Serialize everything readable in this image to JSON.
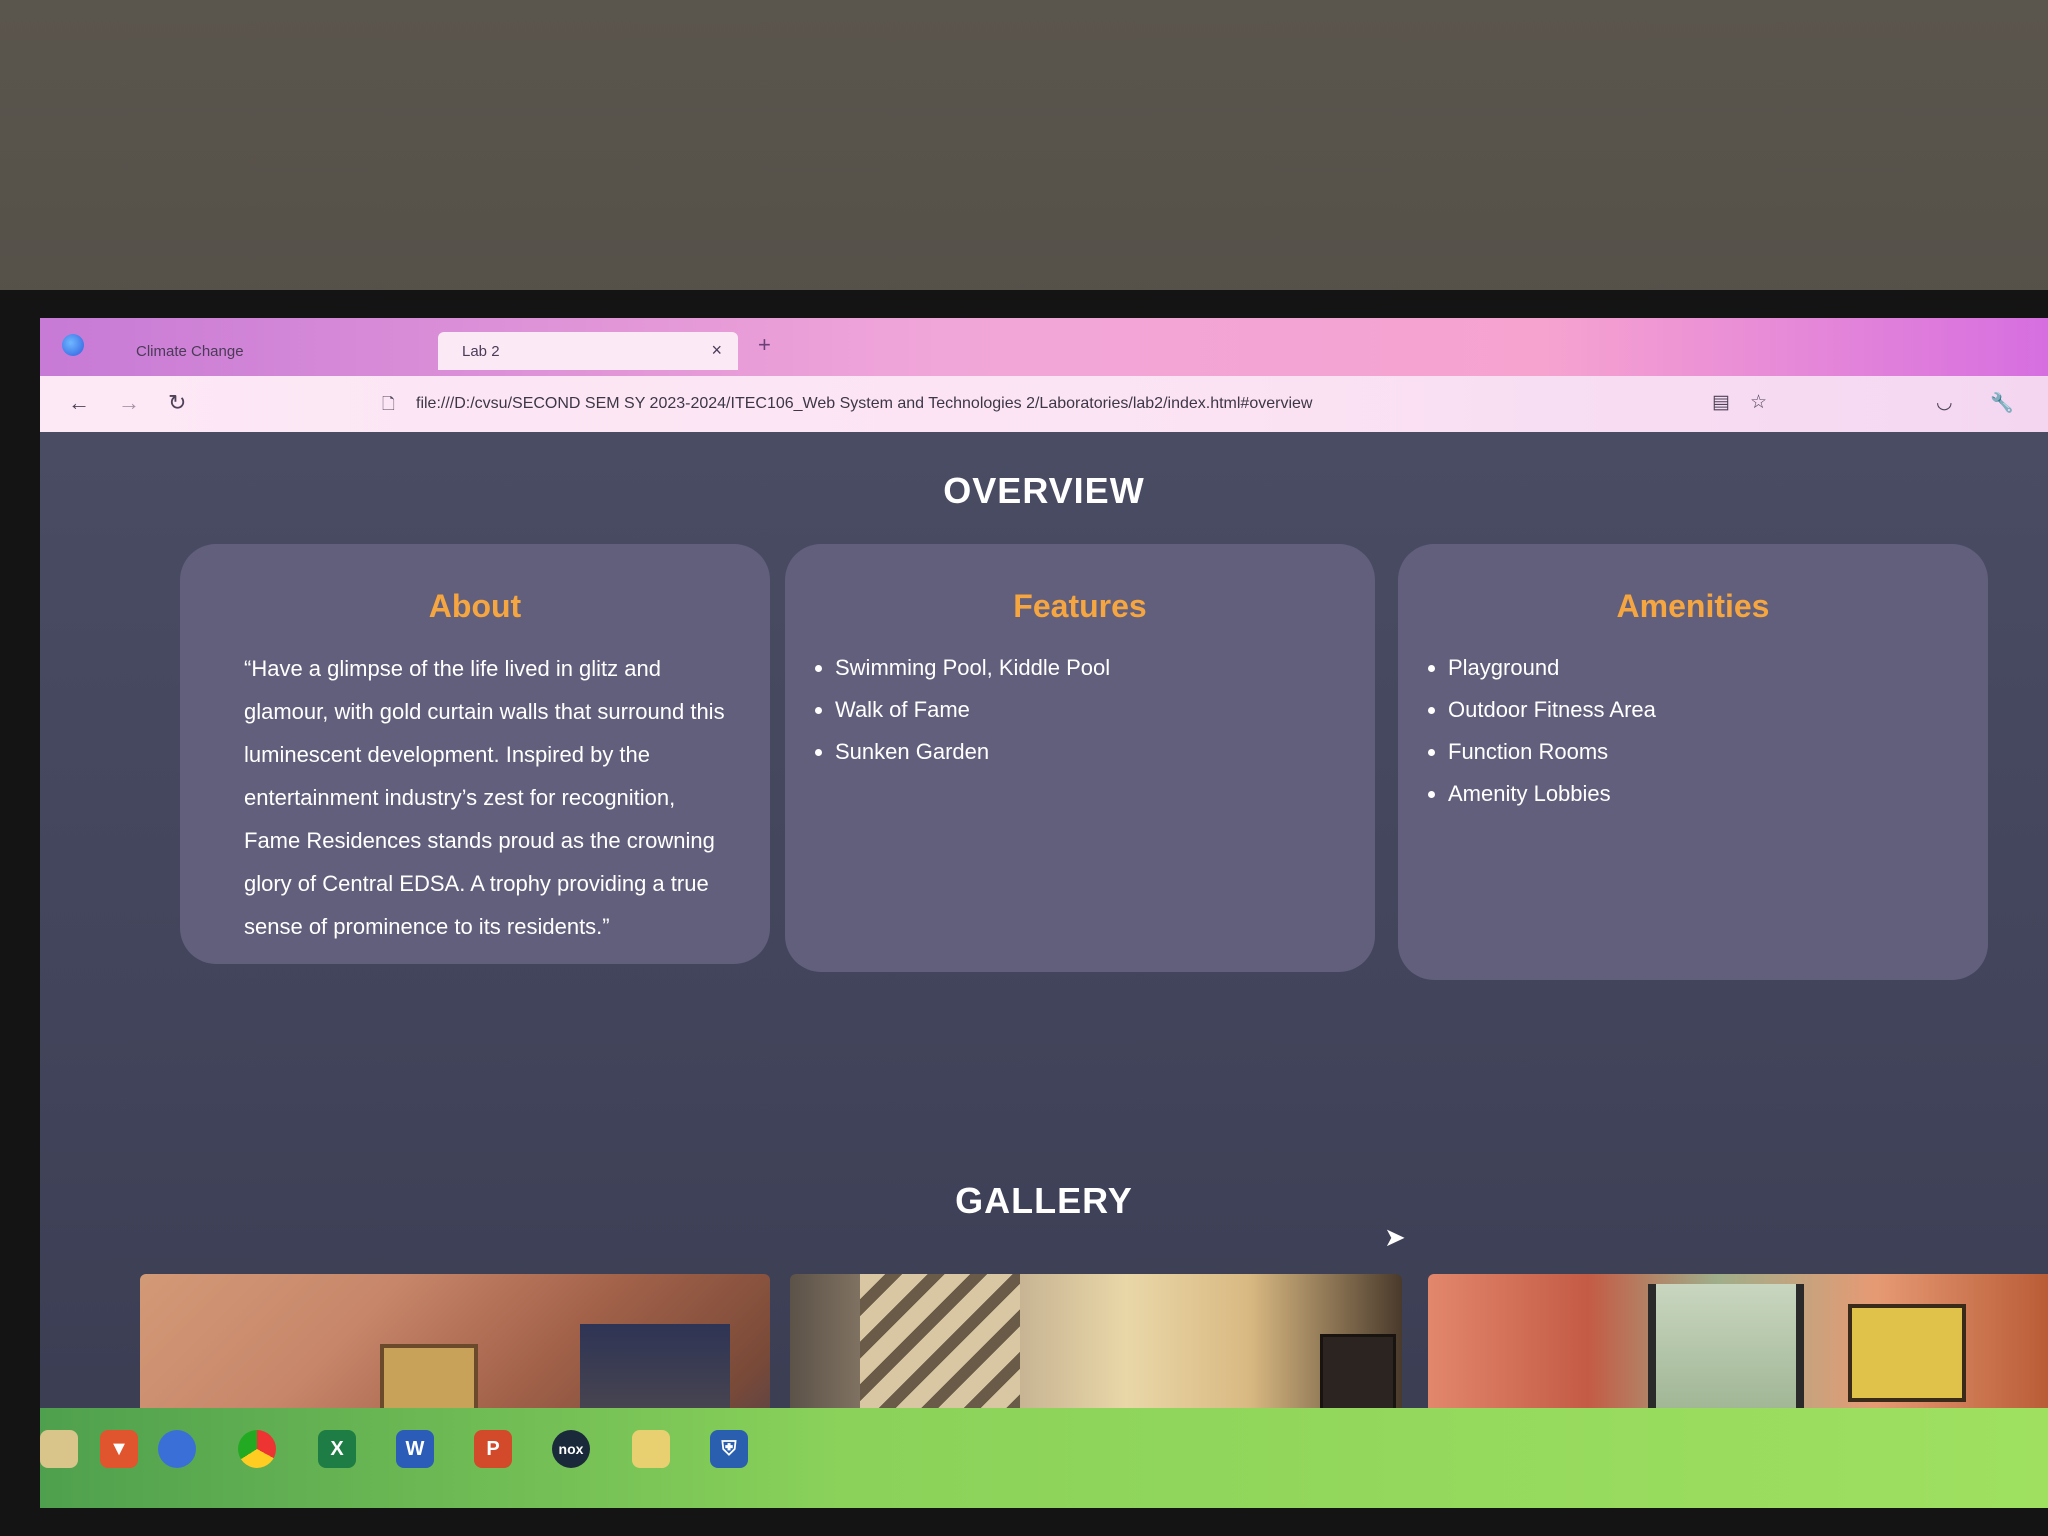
{
  "browser": {
    "tabs": [
      {
        "label": "Climate Change",
        "close": "×"
      },
      {
        "label": "Lab 2",
        "close": "×"
      }
    ],
    "new_tab": "+",
    "url": "file:///D:/cvsu/SECOND SEM SY 2023-2024/ITEC106_Web System and Technologies 2/Laboratories/lab2/index.html#overview",
    "icons": {
      "back": "←",
      "forward": "→",
      "reload": "↻",
      "page": "🗋",
      "reader": "▤",
      "bookmark": "☆",
      "pocket": "◡",
      "tools": "🔧",
      "dropdown": "⌄"
    }
  },
  "overview": {
    "title": "OVERVIEW",
    "about": {
      "heading": "About",
      "text": "“Have a glimpse of the life lived in glitz and glamour, with gold curtain walls that surround this luminescent development. Inspired by the entertainment industry’s zest for recognition, Fame Residences stands proud as the crowning glory of Central EDSA. A trophy providing a true sense of prominence to its residents.”"
    },
    "features": {
      "heading": "Features",
      "items": [
        "Swimming Pool, Kiddle Pool",
        "Walk of Fame",
        "Sunken Garden"
      ]
    },
    "amenities": {
      "heading": "Amenities",
      "items": [
        "Playground",
        "Outdoor Fitness Area",
        "Function Rooms",
        "Amenity Lobbies"
      ]
    }
  },
  "gallery": {
    "title": "GALLERY"
  },
  "taskbar": {
    "apps": [
      "brave-icon",
      "firefox-icon",
      "chrome-icon",
      "excel-icon",
      "word-icon",
      "powerpoint-icon",
      "nox-icon",
      "file-explorer-icon",
      "security-icon"
    ],
    "labels": {
      "excel": "X",
      "word": "W",
      "powerpoint": "P",
      "nox": "nox"
    }
  }
}
